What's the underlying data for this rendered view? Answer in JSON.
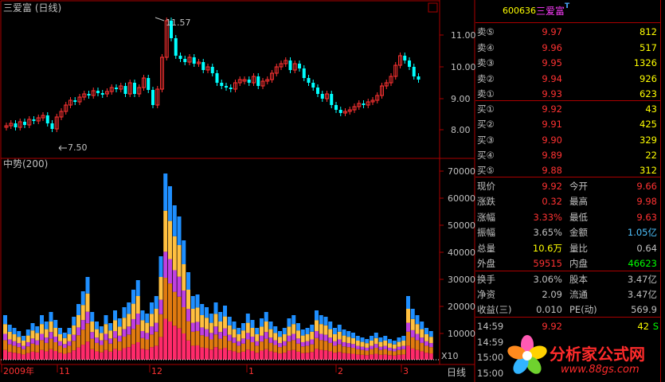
{
  "stock": {
    "code": "600636",
    "name": "三爱富",
    "t_mark": "T"
  },
  "top_chart": {
    "title": "三爱富 (日线)",
    "high_label": "11.57",
    "low_label": "7.50",
    "yticks": [
      "11.00",
      "10.00",
      "9.00",
      "8.00"
    ]
  },
  "bottom_chart": {
    "title": "中势(200)",
    "yticks": [
      "70000",
      "60000",
      "50000",
      "40000",
      "30000",
      "20000",
      "10000"
    ],
    "scale_label": "X10"
  },
  "date_axis": {
    "labels": [
      "2009年",
      "11",
      "12",
      "1",
      "2",
      "3"
    ],
    "period": "日线"
  },
  "order_book": {
    "sell": [
      {
        "label": "卖⑤",
        "price": "9.97",
        "vol": "812"
      },
      {
        "label": "卖④",
        "price": "9.96",
        "vol": "517"
      },
      {
        "label": "卖③",
        "price": "9.95",
        "vol": "1326"
      },
      {
        "label": "卖②",
        "price": "9.94",
        "vol": "926"
      },
      {
        "label": "卖①",
        "price": "9.93",
        "vol": "623"
      }
    ],
    "buy": [
      {
        "label": "买①",
        "price": "9.92",
        "vol": "43"
      },
      {
        "label": "买②",
        "price": "9.91",
        "vol": "425"
      },
      {
        "label": "买③",
        "price": "9.90",
        "vol": "329"
      },
      {
        "label": "买④",
        "price": "9.89",
        "vol": "22"
      },
      {
        "label": "买⑤",
        "price": "9.88",
        "vol": "312"
      }
    ]
  },
  "quote": [
    {
      "l1": "现价",
      "v1": "9.92",
      "c1": "#ff3232",
      "l2": "今开",
      "v2": "9.66",
      "c2": "#ff3232"
    },
    {
      "l1": "涨跌",
      "v1": "0.32",
      "c1": "#ff3232",
      "l2": "最高",
      "v2": "9.98",
      "c2": "#ff3232"
    },
    {
      "l1": "涨幅",
      "v1": "3.33%",
      "c1": "#ff3232",
      "l2": "最低",
      "v2": "9.63",
      "c2": "#ff3232"
    },
    {
      "l1": "振幅",
      "v1": "3.65%",
      "c1": "#c0c0c0",
      "l2": "金额",
      "v2": "1.05亿",
      "c2": "#4fc3ff"
    },
    {
      "l1": "总量",
      "v1": "10.6万",
      "c1": "#ffff00",
      "l2": "量比",
      "v2": "0.64",
      "c2": "#c0c0c0"
    },
    {
      "l1": "外盘",
      "v1": "59515",
      "c1": "#ff3232",
      "l2": "内盘",
      "v2": "46623",
      "c2": "#00ff00"
    }
  ],
  "finance": [
    {
      "l1": "换手",
      "v1": "3.06%",
      "l2": "股本",
      "v2": "3.47亿"
    },
    {
      "l1": "净资",
      "v1": "2.09",
      "l2": "流通",
      "v2": "3.47亿"
    },
    {
      "l1": "收益(三)",
      "v1": "0.010",
      "l2": "PE(动)",
      "v2": "569.9"
    }
  ],
  "ticks": [
    {
      "time": "14:59",
      "price": "9.92",
      "vol": "42",
      "bs": "S"
    },
    {
      "time": "14:59",
      "price": "",
      "vol": "",
      "bs": ""
    },
    {
      "time": "15:00",
      "price": "",
      "vol": "",
      "bs": ""
    },
    {
      "time": "15:00",
      "price": "",
      "vol": "",
      "bs": ""
    }
  ],
  "watermark": {
    "text": "分析家公式网",
    "url": "www.88gs.com"
  },
  "colors": {
    "up": "#ff3232",
    "down": "#00ffff",
    "grid": "#aa0000",
    "vol_pink": "#ff2a6a",
    "vol_orange": "#e07a10",
    "vol_magenta": "#c040e0",
    "vol_gold": "#ffc040",
    "vol_blue": "#1f8fff"
  }
}
